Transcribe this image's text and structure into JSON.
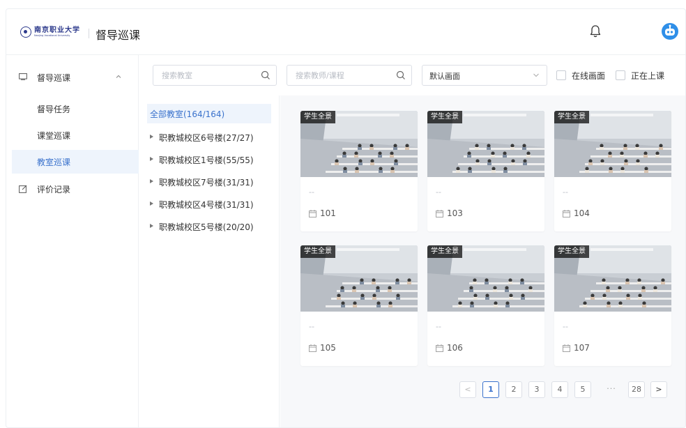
{
  "header": {
    "logo_cn": "南京职业大学",
    "logo_en": "Nanjing Vocational University",
    "title": "督导巡课",
    "icons": [
      "bell-icon",
      "robot-avatar"
    ]
  },
  "sidebar": {
    "group_label": "督导巡课",
    "items": [
      {
        "label": "督导任务",
        "active": false
      },
      {
        "label": "课堂巡课",
        "active": false
      },
      {
        "label": "教室巡课",
        "active": true
      }
    ],
    "eval_label": "评价记录"
  },
  "toolbar": {
    "search_room_placeholder": "搜索教室",
    "search_teacher_placeholder": "搜索教师/课程",
    "view_select": "默认画面",
    "check_online": "在线画面",
    "check_in_class": "正在上课"
  },
  "tree": {
    "root": "全部教室(164/164)",
    "nodes": [
      "职教城校区6号楼(27/27)",
      "职教城校区1号楼(55/55)",
      "职教城校区7号楼(31/31)",
      "职教城校区4号楼(31/31)",
      "职教城校区5号楼(20/20)"
    ]
  },
  "cards": [
    {
      "badge": "学生全景",
      "teacher": "--",
      "room": "101"
    },
    {
      "badge": "学生全景",
      "teacher": "--",
      "room": "103"
    },
    {
      "badge": "学生全景",
      "teacher": "--",
      "room": "104"
    },
    {
      "badge": "学生全景",
      "teacher": "--",
      "room": "105"
    },
    {
      "badge": "学生全景",
      "teacher": "--",
      "room": "106"
    },
    {
      "badge": "学生全景",
      "teacher": "--",
      "room": "107"
    }
  ],
  "pagination": {
    "prev": "<",
    "pages": [
      "1",
      "2",
      "3",
      "4",
      "5"
    ],
    "dots": "···",
    "last": "28",
    "next": ">",
    "current": "1"
  },
  "colors": {
    "accent": "#3a72cc",
    "active_bg": "#eef4fc",
    "grid_bg": "#f7f8fa"
  }
}
